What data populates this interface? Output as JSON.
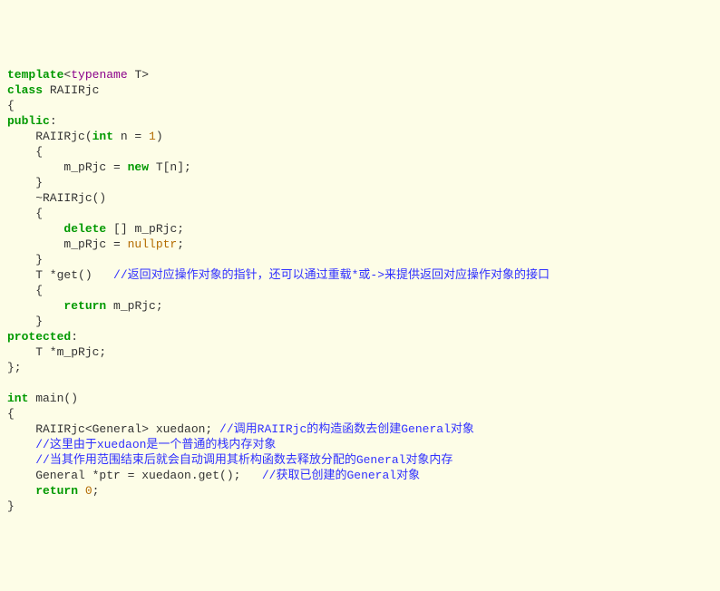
{
  "code": {
    "l1_template": "template",
    "l1_open": "<",
    "l1_typename": "typename",
    "l1_T": " T",
    "l1_close": ">",
    "l2_class": "class",
    "l2_name": " RAIIRjc",
    "l3": "{",
    "l4_public": "public",
    "l4_colon": ":",
    "l5_indent": "    RAIIRjc(",
    "l5_int": "int",
    "l5_n": " n = ",
    "l5_one": "1",
    "l5_close": ")",
    "l6": "    {",
    "l7a": "        m_pRjc = ",
    "l7_new": "new",
    "l7b": " T[n];",
    "l8": "    }",
    "l9": "    ~RAIIRjc()",
    "l10": "    {",
    "l11a": "        ",
    "l11_delete": "delete",
    "l11b": " [] m_pRjc;",
    "l12a": "        m_pRjc = ",
    "l12_null": "nullptr",
    "l12b": ";",
    "l13": "    }",
    "l14a": "    T *get()   ",
    "l14_cmt": "//返回对应操作对象的指针，还可以通过重载*或->来提供返回对应操作对象的接口",
    "l15": "    {",
    "l16a": "        ",
    "l16_return": "return",
    "l16b": " m_pRjc;",
    "l17": "    }",
    "l18_protected": "protected",
    "l18_colon": ":",
    "l19": "    T *m_pRjc;",
    "l20": "};",
    "l21": "",
    "l22_int": "int",
    "l22_main": " main()",
    "l23": "{",
    "l24a": "    RAIIRjc<General> xuedaon; ",
    "l24_cmt": "//调用RAIIRjc的构造函数去创建General对象",
    "l25a": "    ",
    "l25_cmt": "//这里由于xuedaon是一个普通的栈内存对象",
    "l26a": "    ",
    "l26_cmt": "//当其作用范围结束后就会自动调用其析构函数去释放分配的General对象内存",
    "l27a": "    General *ptr = xuedaon.get();   ",
    "l27_cmt": "//获取已创建的General对象",
    "l28a": "    ",
    "l28_return": "return",
    "l28b": " ",
    "l28_zero": "0",
    "l28c": ";",
    "l29": "}"
  }
}
